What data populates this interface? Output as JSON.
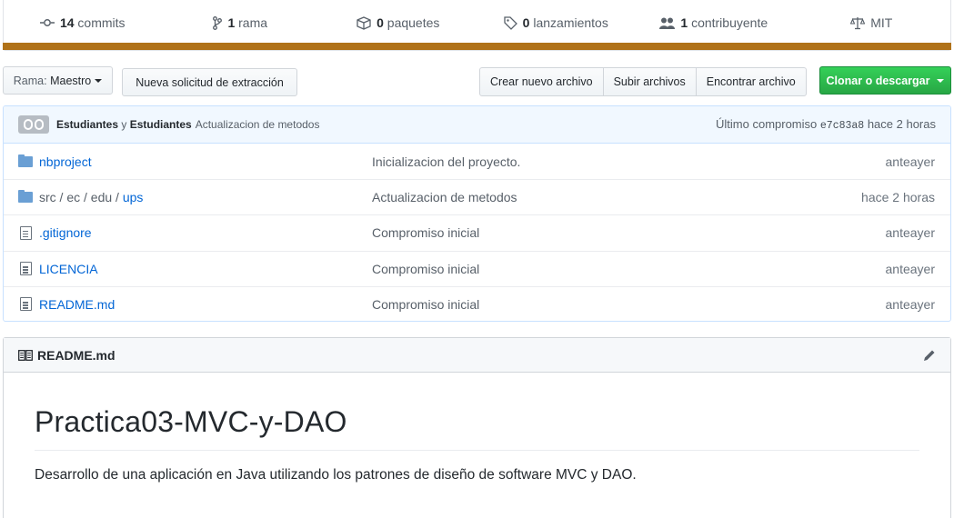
{
  "summary": {
    "commits_count": "14",
    "commits_label": "commits",
    "branches_count": "1",
    "branches_label": "rama",
    "packages_count": "0",
    "packages_label": "paquetes",
    "releases_count": "0",
    "releases_label": "lanzamientos",
    "contributors_count": "1",
    "contributors_label": "contribuyente",
    "license": "MIT",
    "language_color": "#b07219"
  },
  "toolbar": {
    "branch_prefix": "Rama:",
    "branch_name": "Maestro",
    "new_pr": "Nueva solicitud de extracción",
    "create_file": "Crear nuevo archivo",
    "upload_files": "Subir archivos",
    "find_file": "Encontrar archivo",
    "clone": "Clonar o descargar"
  },
  "latest_commit": {
    "author1": "Estudiantes",
    "conjunction": "y",
    "author2": "Estudiantes",
    "message": "Actualizacion de metodos",
    "label": "Último compromiso",
    "sha": "e7c83a8",
    "age": "hace 2 horas"
  },
  "files": [
    {
      "name": "nbproject",
      "type": "folder",
      "message": "Inicializacion del proyecto.",
      "age": "anteayer"
    },
    {
      "path_prefix": "src / ec / edu /",
      "name": "ups",
      "type": "folder",
      "message": "Actualizacion de metodos",
      "age": "hace 2 horas"
    },
    {
      "name": ".gitignore",
      "type": "file",
      "message": "Compromiso inicial",
      "age": "anteayer"
    },
    {
      "name": "LICENCIA",
      "type": "file",
      "message": "Compromiso inicial",
      "age": "anteayer"
    },
    {
      "name": "README.md",
      "type": "file",
      "message": "Compromiso inicial",
      "age": "anteayer"
    }
  ],
  "readme": {
    "filename": "README.md",
    "title": "Practica03-MVC-y-DAO",
    "description": "Desarrollo de una aplicación en Java utilizando los patrones de diseño de software MVC y DAO."
  }
}
